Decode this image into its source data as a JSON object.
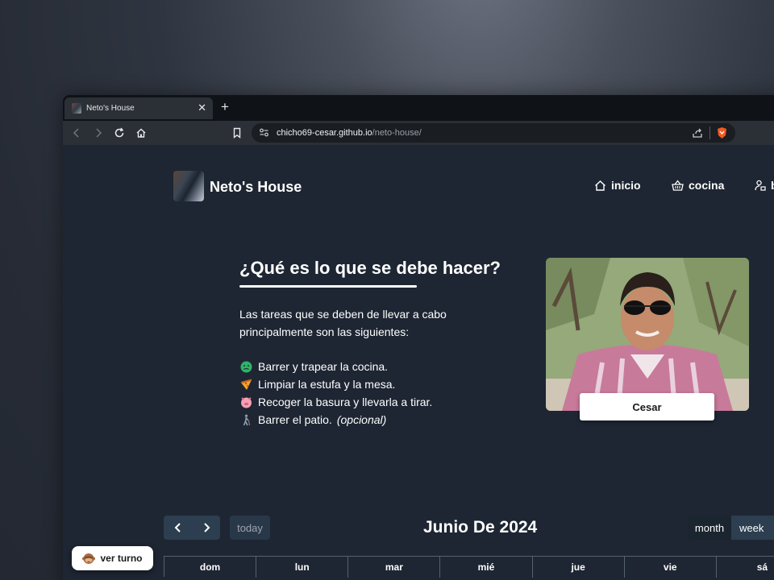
{
  "browser": {
    "tab_title": "Neto's House",
    "new_tab": "+",
    "close": "✕",
    "url_domain": "chicho69-cesar.github.io",
    "url_path": "/neto-house/"
  },
  "site": {
    "title": "Neto's House",
    "nav": [
      {
        "label": "inicio",
        "icon": "home-icon"
      },
      {
        "label": "cocina",
        "icon": "basket-icon"
      },
      {
        "label": "b",
        "icon": "user-lock-icon"
      }
    ]
  },
  "section": {
    "heading": "¿Qué es lo que se debe hacer?",
    "intro": "Las tareas que se deben de llevar a cabo principalmente son las siguientes:",
    "tasks": [
      {
        "text": "Barrer y trapear la cocina.",
        "icon": "nauseated-face-emoji",
        "color": "#2fb36a"
      },
      {
        "text": "Limpiar la estufa y la mesa.",
        "icon": "pizza-emoji",
        "color": "#f4a52c"
      },
      {
        "text": "Recoger la basura y llevarla a tirar.",
        "icon": "pig-face-emoji",
        "color": "#f5a0b5"
      },
      {
        "text": "Barrer el patio.",
        "optional": "(opcional)",
        "icon": "person-walking-cane-emoji",
        "color": "#8aa0b4"
      }
    ]
  },
  "card": {
    "name": "Cesar"
  },
  "calendar": {
    "title": "Junio De 2024",
    "prev": "‹",
    "next": "›",
    "today": "today",
    "views": [
      "month",
      "week"
    ],
    "days": [
      "dom",
      "lun",
      "mar",
      "mié",
      "jue",
      "vie",
      "sá"
    ]
  },
  "floating": {
    "label": "ver turno",
    "icon": "see-no-evil-monkey-emoji"
  },
  "colors": {
    "page_bg": "#1e2633",
    "button_bg": "#2c3e50",
    "button_active": "#1a252f"
  }
}
